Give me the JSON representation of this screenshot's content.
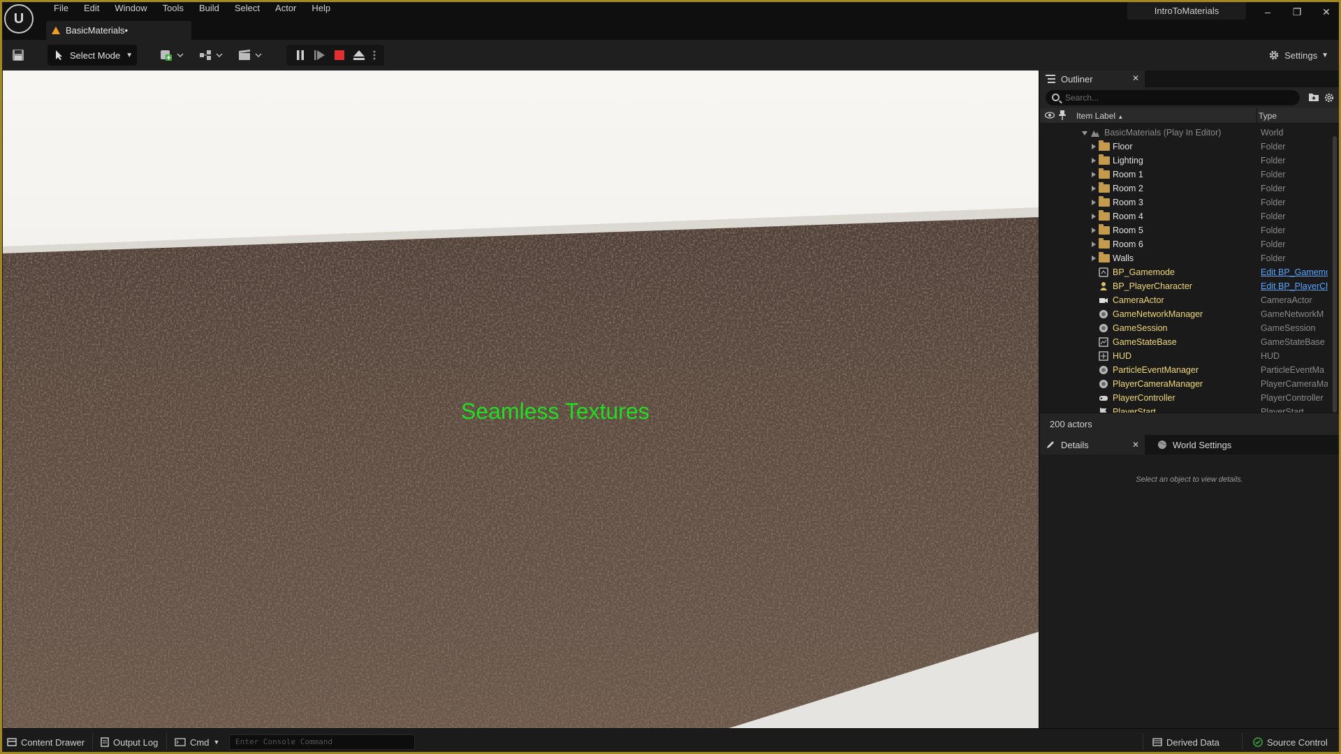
{
  "window": {
    "menu": [
      "File",
      "Edit",
      "Window",
      "Tools",
      "Build",
      "Select",
      "Actor",
      "Help"
    ],
    "doc_tab": "BasicMaterials•",
    "project_name": "IntroToMaterials",
    "controls": [
      "–",
      "❐",
      "✕"
    ]
  },
  "toolbar": {
    "select_mode": "Select Mode",
    "settings": "Settings"
  },
  "viewport": {
    "overlay_text": "Seamless Textures",
    "overlay_color": "#22dd22"
  },
  "outliner": {
    "tab_label": "Outliner",
    "search_placeholder": "Search...",
    "col_label": "Item Label",
    "col_type": "Type",
    "root": {
      "label": "BasicMaterials (Play In Editor)",
      "type": "World"
    },
    "folders": [
      {
        "label": "Floor",
        "type": "Folder"
      },
      {
        "label": "Lighting",
        "type": "Folder"
      },
      {
        "label": "Room 1",
        "type": "Folder"
      },
      {
        "label": "Room 2",
        "type": "Folder"
      },
      {
        "label": "Room 3",
        "type": "Folder"
      },
      {
        "label": "Room 4",
        "type": "Folder"
      },
      {
        "label": "Room 5",
        "type": "Folder"
      },
      {
        "label": "Room 6",
        "type": "Folder"
      },
      {
        "label": "Walls",
        "type": "Folder"
      }
    ],
    "actors": [
      {
        "label": "BP_Gamemode",
        "type": "Edit BP_Gamemode",
        "link": true,
        "icon": "blueprint-icon"
      },
      {
        "label": "BP_PlayerCharacter",
        "type": "Edit BP_PlayerCh",
        "link": true,
        "icon": "pawn-icon"
      },
      {
        "label": "CameraActor",
        "type": "CameraActor",
        "link": false,
        "icon": "camera-icon"
      },
      {
        "label": "GameNetworkManager",
        "type": "GameNetworkM",
        "link": false,
        "icon": "actor-icon"
      },
      {
        "label": "GameSession",
        "type": "GameSession",
        "link": false,
        "icon": "actor-icon"
      },
      {
        "label": "GameStateBase",
        "type": "GameStateBase",
        "link": false,
        "icon": "gamestate-icon"
      },
      {
        "label": "HUD",
        "type": "HUD",
        "link": false,
        "icon": "hud-icon"
      },
      {
        "label": "ParticleEventManager",
        "type": "ParticleEventMa",
        "link": false,
        "icon": "actor-icon"
      },
      {
        "label": "PlayerCameraManager",
        "type": "PlayerCameraMa",
        "link": false,
        "icon": "actor-icon"
      },
      {
        "label": "PlayerController",
        "type": "PlayerController",
        "link": false,
        "icon": "gamepad-icon"
      },
      {
        "label": "PlayerStart",
        "type": "PlayerStart",
        "link": false,
        "icon": "flag-icon"
      }
    ],
    "actor_count": "200 actors"
  },
  "details": {
    "tab_label": "Details",
    "world_settings_label": "World Settings",
    "empty_hint": "Select an object to view details."
  },
  "statusbar": {
    "content_drawer": "Content Drawer",
    "output_log": "Output Log",
    "cmd": "Cmd",
    "console_placeholder": "Enter Console Command",
    "derived_data": "Derived Data",
    "source_control": "Source Control"
  },
  "colors": {
    "accent_border": "#a38a1b",
    "actor_label": "#f0d878",
    "link": "#5aa5ff",
    "play_stop": "#e03030"
  }
}
